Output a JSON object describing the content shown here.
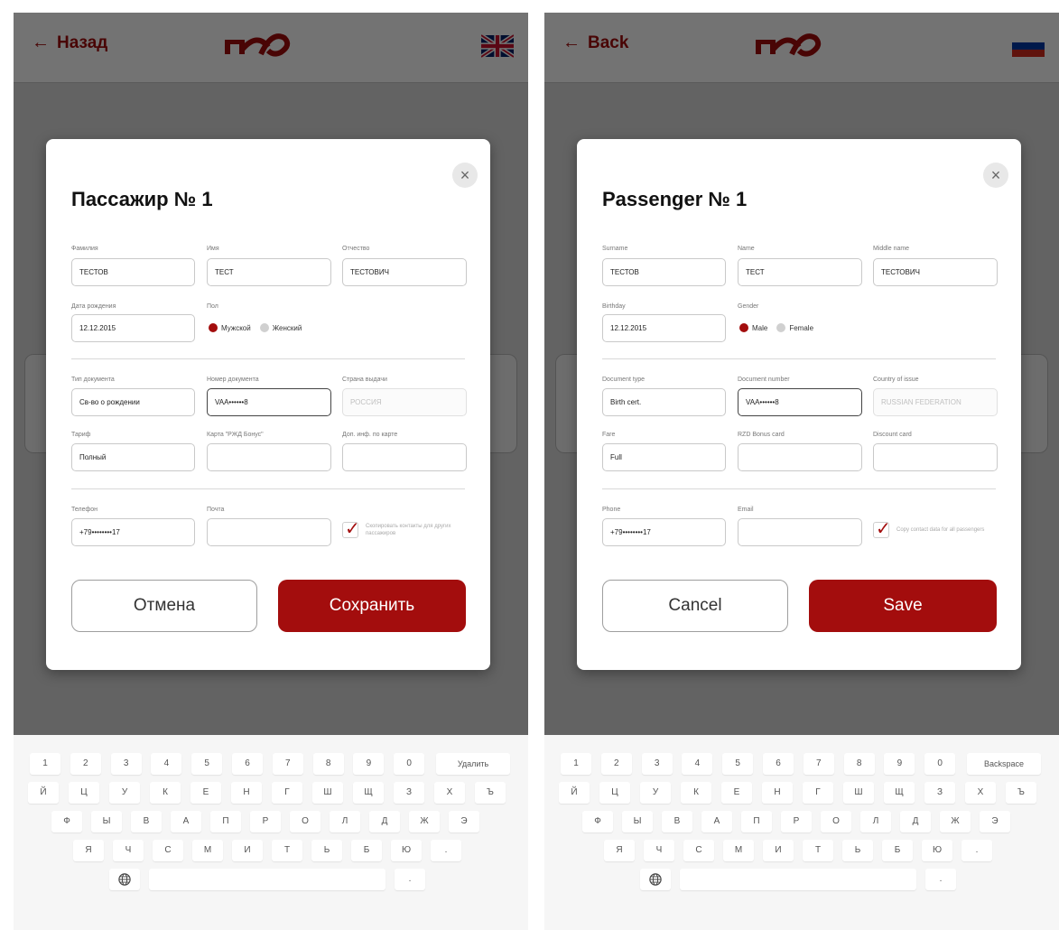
{
  "brand": {
    "logo_text": "РЖД",
    "accent_color": "#a30d0d"
  },
  "screens": {
    "ru": {
      "back_label": "Назад",
      "flag_icon": "uk-flag-icon",
      "modal": {
        "title": "Пассажир № 1",
        "surname_label": "Фамилия",
        "surname_value": "ТЕСТОВ",
        "name_label": "Имя",
        "name_value": "ТЕСТ",
        "middle_label": "Отчество",
        "middle_value": "ТЕСТОВИЧ",
        "birth_label": "Дата рождения",
        "birth_value": "12.12.2015",
        "gender_label": "Пол",
        "gender_male": "Мужской",
        "gender_female": "Женский",
        "doctype_label": "Тип документа",
        "doctype_value": "Св-во о рождении",
        "docnum_label": "Номер документа",
        "docnum_value": "VAA••••••8",
        "country_label": "Страна выдачи",
        "country_value": "РОССИЯ",
        "tariff_label": "Тариф",
        "tariff_value": "Полный",
        "bonus_label": "Карта \"РЖД Бонус\"",
        "discount_label": "Доп. инф. по карте",
        "phone_label": "Телефон",
        "phone_value": "+79••••••••17",
        "email_label": "Почта",
        "copy_contacts": "Скопировать контакты для других пассажиров",
        "cancel": "Отмена",
        "save": "Сохранить"
      },
      "keyboard": {
        "delete": "Удалить"
      }
    },
    "en": {
      "back_label": "Back",
      "flag_icon": "russia-flag-icon",
      "modal": {
        "title": "Passenger № 1",
        "surname_label": "Surname",
        "surname_value": "ТЕСТОВ",
        "name_label": "Name",
        "name_value": "ТЕСТ",
        "middle_label": "Middle name",
        "middle_value": "ТЕСТОВИЧ",
        "birth_label": "Birthday",
        "birth_value": "12.12.2015",
        "gender_label": "Gender",
        "gender_male": "Male",
        "gender_female": "Female",
        "doctype_label": "Document type",
        "doctype_value": "Birth cert.",
        "docnum_label": "Document number",
        "docnum_value": "VAA••••••8",
        "country_label": "Country of issue",
        "country_value": "RUSSIAN FEDERATION",
        "tariff_label": "Fare",
        "tariff_value": "Full",
        "bonus_label": "RZD Bonus card",
        "discount_label": "Discount card",
        "phone_label": "Phone",
        "phone_value": "+79••••••••17",
        "email_label": "Email",
        "copy_contacts": "Copy contact data for all passengers",
        "cancel": "Cancel",
        "save": "Save"
      },
      "keyboard": {
        "delete": "Backspace"
      }
    }
  },
  "keyboard_rows": [
    [
      "1",
      "2",
      "3",
      "4",
      "5",
      "6",
      "7",
      "8",
      "9",
      "0"
    ],
    [
      "Й",
      "Ц",
      "У",
      "К",
      "Е",
      "Н",
      "Г",
      "Ш",
      "Щ",
      "З",
      "Х",
      "Ъ"
    ],
    [
      "Ф",
      "Ы",
      "В",
      "А",
      "П",
      "Р",
      "О",
      "Л",
      "Д",
      "Ж",
      "Э"
    ],
    [
      "Я",
      "Ч",
      "С",
      "М",
      "И",
      "Т",
      "Ь",
      "Б",
      "Ю",
      "."
    ]
  ],
  "keyboard_extra": {
    "globe_icon": "globe-icon",
    "space": "",
    "period": "."
  }
}
